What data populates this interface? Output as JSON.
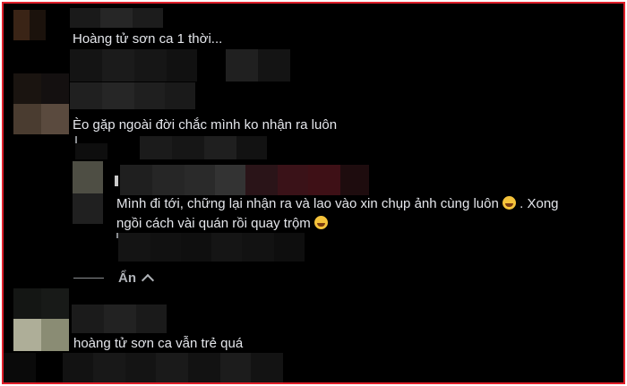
{
  "comments": [
    {
      "text": "Hoàng tử sơn ca 1 thời..."
    },
    {
      "text": "Èo gặp ngoài đời chắc mình ko nhận ra luôn"
    },
    {
      "text_line1": "Mình đi tới, chững lại nhận ra và lao vào xin chụp ảnh cùng luôn",
      "text_line1_tail": ". Xong",
      "text_line2": "ngồi cách vài quán rồi quay trộm",
      "emoji": "grinning-sweat-emoji"
    },
    {
      "text": "hoàng tử sơn ca vẫn trẻ quá"
    }
  ],
  "replies_toggle": {
    "label": "Ẩn"
  },
  "colors": {
    "frame_border": "#e0202b",
    "background": "#000000",
    "text": "#e4e6eb",
    "muted": "#b0b3b8"
  }
}
